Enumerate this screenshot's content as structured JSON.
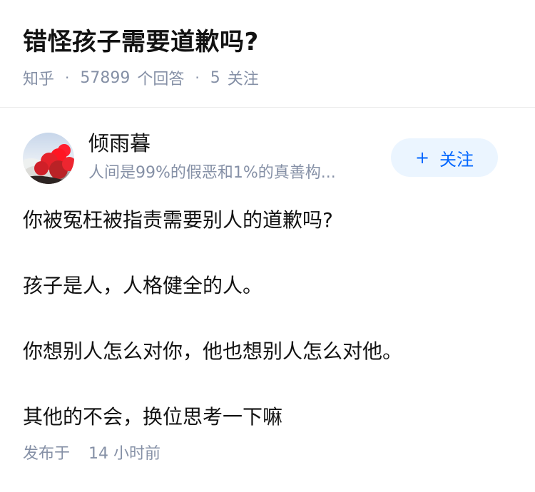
{
  "question": {
    "title": "错怪孩子需要道歉吗?",
    "source": "知乎",
    "answer_count": "57899",
    "answer_label": "个回答",
    "follower_count": "5",
    "follower_label": "关注"
  },
  "author": {
    "name": "倾雨暮",
    "bio": "人间是99%的假恶和1%的真善构...",
    "follow_label": "关注",
    "follow_plus": "+"
  },
  "answer": {
    "paragraphs": [
      "你被冤枉被指责需要别人的道歉吗?",
      "孩子是人，人格健全的人。",
      "你想别人怎么对你，他也想别人怎么对他。",
      "其他的不会，换位思考一下嘛"
    ],
    "published_label": "发布于",
    "published_time": "14 小时前"
  },
  "colors": {
    "accent": "#0066ff",
    "follow_bg": "#ebf5ff",
    "meta": "#8590a6",
    "text": "#121212",
    "divider": "#ebebeb"
  }
}
